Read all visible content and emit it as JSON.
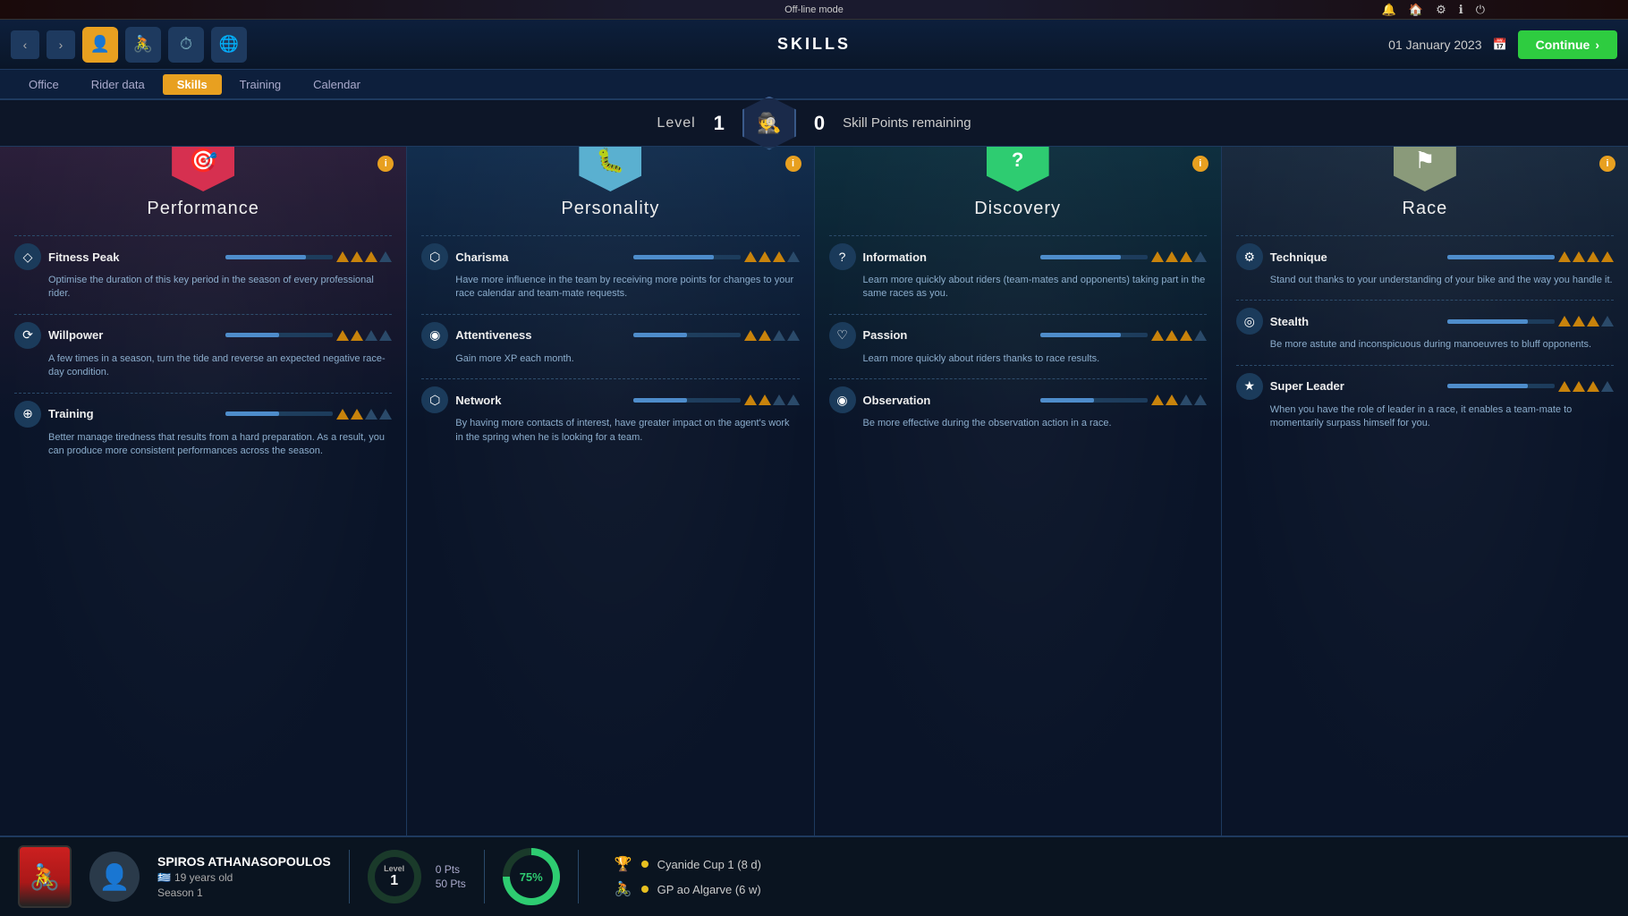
{
  "topbar": {
    "mode": "Off-line mode"
  },
  "navbar": {
    "title": "SKILLS",
    "date": "01 January 2023",
    "continue_label": "Continue"
  },
  "subtabs": [
    {
      "label": "Office",
      "active": false
    },
    {
      "label": "Rider data",
      "active": false
    },
    {
      "label": "Skills",
      "active": true
    },
    {
      "label": "Training",
      "active": false
    },
    {
      "label": "Calendar",
      "active": false
    }
  ],
  "levelbar": {
    "level_label": "Level",
    "level": "1",
    "skill_points": "0",
    "skill_points_label": "Skill Points remaining"
  },
  "columns": [
    {
      "id": "performance",
      "title": "Performance",
      "color": "performance",
      "icon": "🎯",
      "skills": [
        {
          "name": "Fitness Peak",
          "icon": "◇",
          "desc": "Optimise the duration of this key period in the season of every professional rider.",
          "bars": 3,
          "filled": 3
        },
        {
          "name": "Willpower",
          "icon": "⟳",
          "desc": "A few times in a season, turn the tide and reverse an expected negative race-day condition.",
          "bars": 4,
          "filled": 2
        },
        {
          "name": "Training",
          "icon": "⊕",
          "desc": "Better manage tiredness that results from a hard preparation. As a result, you can produce more consistent performances across the season.",
          "bars": 4,
          "filled": 2
        }
      ]
    },
    {
      "id": "personality",
      "title": "Personality",
      "color": "personality",
      "icon": "🐛",
      "skills": [
        {
          "name": "Charisma",
          "icon": "⬡",
          "desc": "Have more influence in the team by receiving more points for changes to your race calendar and team-mate requests.",
          "bars": 4,
          "filled": 3
        },
        {
          "name": "Attentiveness",
          "icon": "◉",
          "desc": "Gain more XP each month.",
          "bars": 4,
          "filled": 2
        },
        {
          "name": "Network",
          "icon": "⬡",
          "desc": "By having more contacts of interest, have greater impact on the agent's work in the spring when he is looking for a team.",
          "bars": 4,
          "filled": 2
        }
      ]
    },
    {
      "id": "discovery",
      "title": "Discovery",
      "color": "discovery",
      "icon": "?",
      "skills": [
        {
          "name": "Information",
          "icon": "?",
          "desc": "Learn more quickly about riders (team-mates and opponents) taking part in the same races as you.",
          "bars": 4,
          "filled": 3
        },
        {
          "name": "Passion",
          "icon": "♡",
          "desc": "Learn more quickly about riders thanks to race results.",
          "bars": 4,
          "filled": 3
        },
        {
          "name": "Observation",
          "icon": "◉",
          "desc": "Be more effective during the observation action in a race.",
          "bars": 4,
          "filled": 2
        }
      ]
    },
    {
      "id": "race",
      "title": "Race",
      "color": "race",
      "icon": "⚑",
      "skills": [
        {
          "name": "Technique",
          "icon": "⚙",
          "desc": "Stand out thanks to your understanding of your bike and the way you handle it.",
          "bars": 4,
          "filled": 4
        },
        {
          "name": "Stealth",
          "icon": "◎",
          "desc": "Be more astute and inconspicuous during manoeuvres to bluff opponents.",
          "bars": 4,
          "filled": 3
        },
        {
          "name": "Super Leader",
          "icon": "★",
          "desc": "When you have the role of leader in a race, it enables a team-mate to momentarily surpass himself for you.",
          "bars": 4,
          "filled": 3
        }
      ]
    }
  ],
  "bottombar": {
    "rider_name": "SPIROS ATHANASOPOULOS",
    "rider_age": "19 years old",
    "rider_season": "Season 1",
    "rider_flag": "🇬🇷",
    "level_label": "Level",
    "level": "1",
    "pts_current": "0 Pts",
    "pts_total": "50 Pts",
    "progress_pct": "75%",
    "race1": "Cyanide Cup 1 (8 d)",
    "race2": "GP ao Algarve (6 w)"
  },
  "icons": {
    "back": "‹",
    "forward": "›",
    "nav_person": "👤",
    "nav_cycle": "🚴",
    "nav_clock": "🕐",
    "nav_globe": "🌐",
    "calendar_icon": "📅",
    "continue_arrow": "›",
    "bell": "🔔",
    "home": "🏠",
    "gear": "⚙",
    "info_i": "i",
    "info_badge": "i",
    "trophy": "🏆",
    "race_icon": "🚴"
  }
}
